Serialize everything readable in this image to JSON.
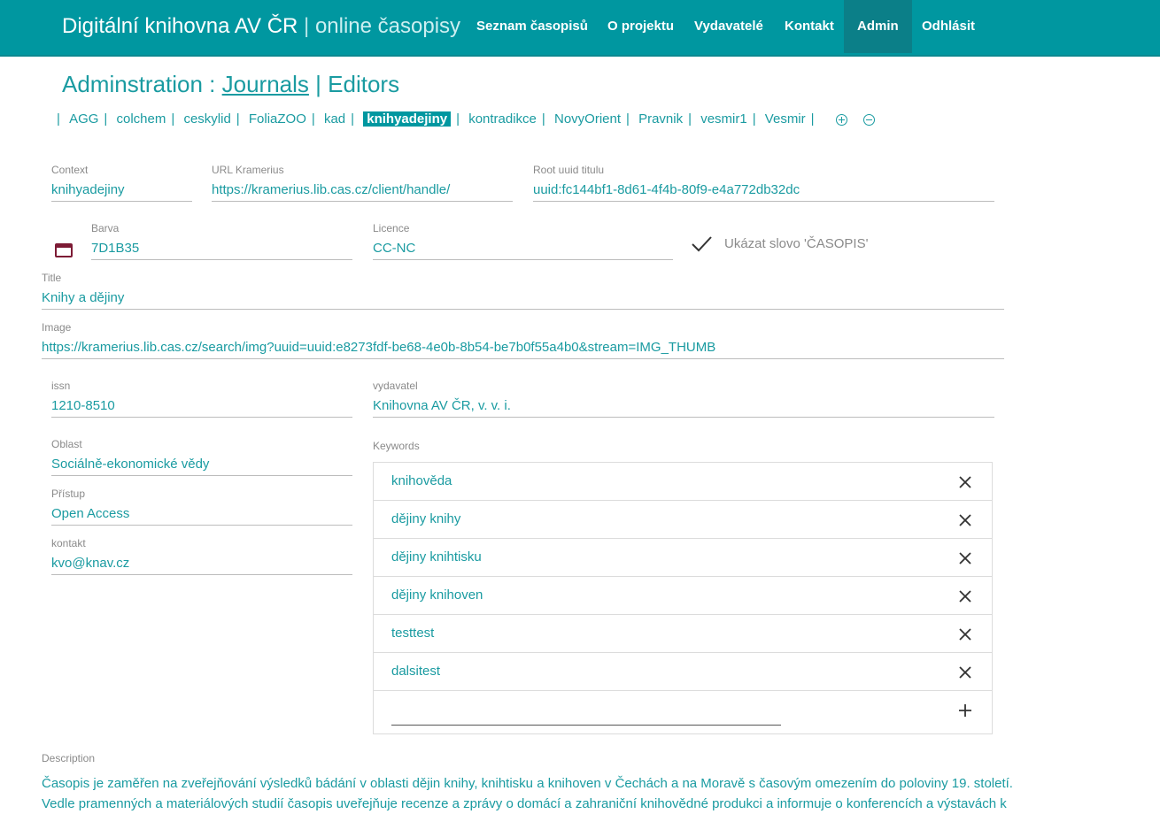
{
  "brand": {
    "title": "Digitální knihovna AV ČR",
    "separator": "|",
    "subtitle": "online časopisy"
  },
  "nav": {
    "items": [
      {
        "label": "Seznam časopisů"
      },
      {
        "label": "O projektu"
      },
      {
        "label": "Vydavatelé"
      },
      {
        "label": "Kontakt"
      },
      {
        "label": "Admin",
        "active": true
      },
      {
        "label": "Odhlásit"
      }
    ]
  },
  "heading": {
    "prefix": "Adminstration :",
    "journals_link": "Journals",
    "separator": "|",
    "editors_link": "Editors"
  },
  "journals": {
    "items": [
      "AGG",
      "colchem",
      "ceskylid",
      "FoliaZOO",
      "kad",
      "knihyadejiny",
      "kontradikce",
      "NovyOrient",
      "Pravnik",
      "vesmir1",
      "Vesmir"
    ],
    "active": "knihyadejiny",
    "add_icon": "plus-circle-icon",
    "remove_icon": "minus-circle-icon"
  },
  "form": {
    "context": {
      "label": "Context",
      "value": "knihyadejiny"
    },
    "url_kramerius": {
      "label": "URL Kramerius",
      "value": "https://kramerius.lib.cas.cz/client/handle/"
    },
    "root_uuid": {
      "label": "Root uuid titulu",
      "value": "uuid:fc144bf1-8d61-4f4b-80f9-e4a772db32dc"
    },
    "color": {
      "label": "Barva",
      "value": "7D1B35",
      "swatch": "#7D1B35"
    },
    "licence": {
      "label": "Licence",
      "value": "CC-NC"
    },
    "show_word": {
      "label": "Ukázat slovo 'ČASOPIS'",
      "checked": true
    },
    "title": {
      "label": "Title",
      "value": "Knihy a dějiny"
    },
    "image": {
      "label": "Image",
      "value": "https://kramerius.lib.cas.cz/search/img?uuid=uuid:e8273fdf-be68-4e0b-8b54-be7b0f55a4b0&stream=IMG_THUMB"
    },
    "issn": {
      "label": "issn",
      "value": "1210-8510"
    },
    "publisher": {
      "label": "vydavatel",
      "value": "Knihovna AV ČR, v. v. i."
    },
    "area": {
      "label": "Oblast",
      "value": "Sociálně-ekonomické vědy"
    },
    "access": {
      "label": "Přístup",
      "value": "Open Access"
    },
    "contact": {
      "label": "kontakt",
      "value": "kvo@knav.cz"
    },
    "keywords": {
      "label": "Keywords",
      "items": [
        "knihověda",
        "dějiny knihy",
        "dějiny knihtisku",
        "dějiny knihoven",
        "testtest",
        "dalsitest"
      ],
      "new_value": ""
    },
    "description": {
      "label": "Description",
      "value": "Časopis je zaměřen na zveřejňování výsledků bádání v oblasti dějin knihy, knihtisku a knihoven v Čechách a na Moravě s časovým omezením do poloviny 19. století. Vedle pramenných a materiálových studií časopis uveřejňuje recenze a zprávy o domácí a zahraniční knihovědné produkci a informuje o konferencích a výstavách k"
    }
  },
  "colors": {
    "brand": "#0097a0",
    "accent_text": "#1a9ba1",
    "active_nav": "#0b7f88"
  }
}
